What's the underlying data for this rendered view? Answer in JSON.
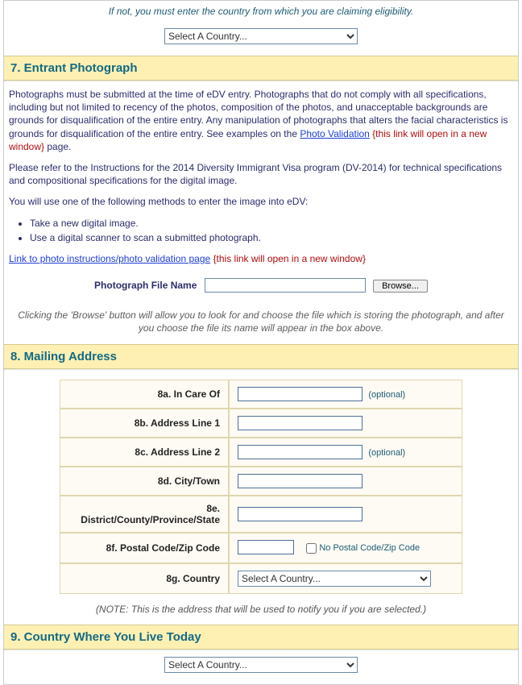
{
  "top_note": "If not, you must enter the country from which you are claiming eligibility.",
  "country_placeholder": "Select A Country...",
  "sec7": {
    "title": "7. Entrant Photograph",
    "para1a": "Photographs must be submitted at the time of eDV entry. Photographs that do not comply with all specifications, including but not limited to recency of the photos, composition of the photos, and unacceptable backgrounds are grounds for disqualification of the entire entry. Any manipulation of photographs that alters the facial characteristics is grounds for disqualification of the entire entry. See examples on the ",
    "photo_validation_link": "Photo Validation",
    "new_window_note": " {this link will open in a new window}",
    "para1b": " page.",
    "para2": "Please refer to the Instructions for the 2014 Diversity Immigrant Visa program (DV-2014) for technical specifications and compositional specifications for the digital image.",
    "para3": "You will use one of the following methods to enter the image into eDV:",
    "methods": [
      "Take a new digital image.",
      "Use a digital scanner to scan a submitted photograph."
    ],
    "link2": "Link to photo instructions/photo validation page",
    "file_label": "Photograph File Name",
    "browse_label": "Browse...",
    "hint": "Clicking the 'Browse' button will allow you to look for and choose the file which is storing the photograph, and after you choose the file its name will appear in the box above."
  },
  "sec8": {
    "title": "8. Mailing Address",
    "rows": {
      "a": "8a. In Care Of",
      "b": "8b. Address Line 1",
      "c": "8c. Address Line 2",
      "d": "8d. City/Town",
      "e": "8e. District/County/Province/State",
      "f": "8f. Postal Code/Zip Code",
      "g": "8g. Country"
    },
    "optional": "(optional)",
    "no_zip": "No Postal Code/Zip Code",
    "note": "(NOTE: This is the address that will be used to notify you if you are selected.)"
  },
  "sec9": {
    "title": "9. Country Where You Live Today"
  }
}
